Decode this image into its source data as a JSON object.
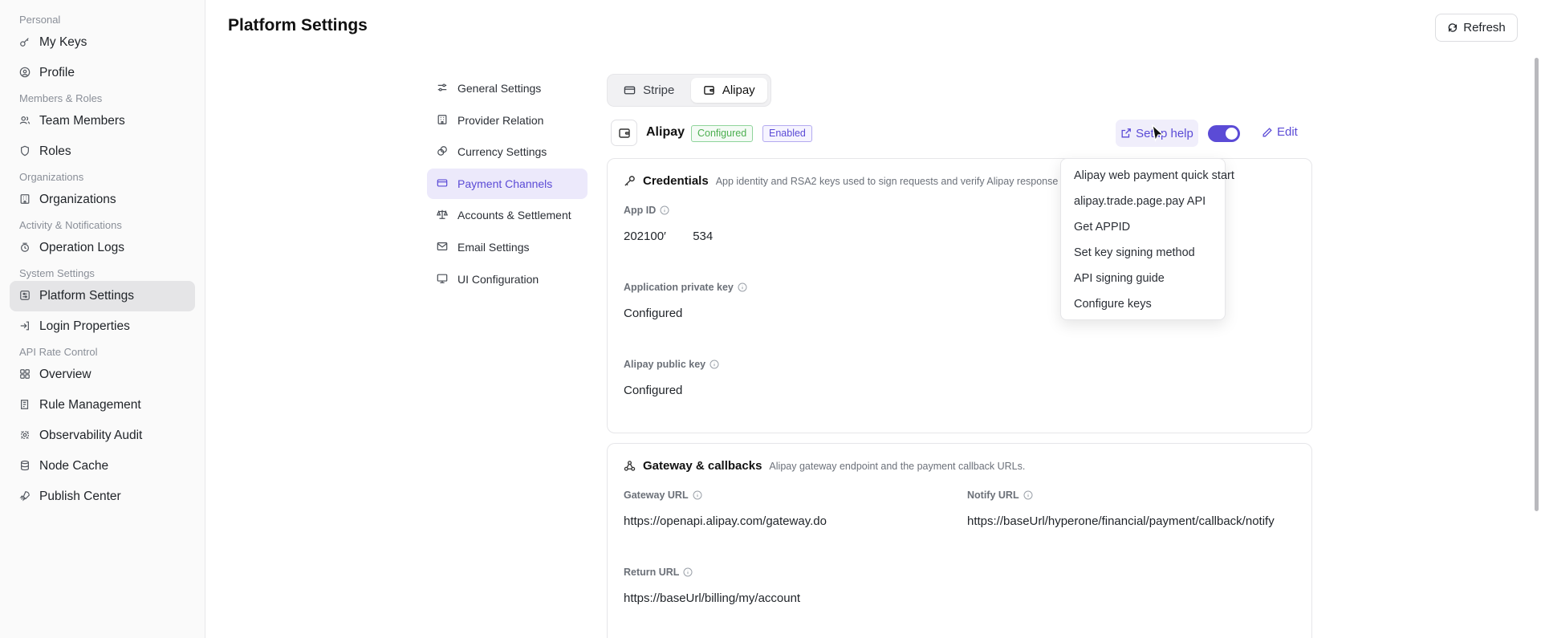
{
  "sidebar": {
    "groups": [
      {
        "label": "Personal",
        "items": [
          {
            "label": "My Keys",
            "icon": "key-icon"
          },
          {
            "label": "Profile",
            "icon": "user-circle-icon"
          }
        ]
      },
      {
        "label": "Members & Roles",
        "items": [
          {
            "label": "Team Members",
            "icon": "users-icon"
          },
          {
            "label": "Roles",
            "icon": "shield-icon"
          }
        ]
      },
      {
        "label": "Organizations",
        "items": [
          {
            "label": "Organizations",
            "icon": "building-icon"
          }
        ]
      },
      {
        "label": "Activity & Notifications",
        "items": [
          {
            "label": "Operation Logs",
            "icon": "log-icon"
          }
        ]
      },
      {
        "label": "System Settings",
        "items": [
          {
            "label": "Platform Settings",
            "icon": "settings-box-icon",
            "active": true
          },
          {
            "label": "Login Properties",
            "icon": "login-icon"
          }
        ]
      },
      {
        "label": "API Rate Control",
        "items": [
          {
            "label": "Overview",
            "icon": "grid-icon"
          },
          {
            "label": "Rule Management",
            "icon": "rules-icon"
          },
          {
            "label": "Observability Audit",
            "icon": "radar-icon"
          },
          {
            "label": "Node Cache",
            "icon": "database-icon"
          },
          {
            "label": "Publish Center",
            "icon": "rocket-icon"
          }
        ]
      }
    ]
  },
  "header": {
    "title": "Platform Settings",
    "refresh_label": "Refresh"
  },
  "settings_nav": [
    {
      "label": "General Settings",
      "icon": "sliders-icon"
    },
    {
      "label": "Provider Relation",
      "icon": "building-icon"
    },
    {
      "label": "Currency Settings",
      "icon": "coins-icon"
    },
    {
      "label": "Payment Channels",
      "icon": "credit-card-icon",
      "active": true
    },
    {
      "label": "Accounts & Settlement",
      "icon": "scale-icon"
    },
    {
      "label": "Email Settings",
      "icon": "mail-icon"
    },
    {
      "label": "UI Configuration",
      "icon": "monitor-icon"
    }
  ],
  "tabs": [
    {
      "label": "Stripe",
      "icon": "credit-card-icon"
    },
    {
      "label": "Alipay",
      "icon": "wallet-icon",
      "active": true
    }
  ],
  "channel": {
    "name": "Alipay",
    "badge_configured": "Configured",
    "badge_enabled": "Enabled",
    "help_label": "Setup help",
    "enabled": true,
    "edit_label": "Edit"
  },
  "credentials": {
    "title": "Credentials",
    "description": "App identity and RSA2 keys used to sign requests and verify Alipay response",
    "app_id_label": "App ID",
    "app_id_value": "202100′        534",
    "private_key_label": "Application private key",
    "private_key_value": "Configured",
    "public_key_label": "Alipay public key",
    "public_key_value": "Configured"
  },
  "gateway": {
    "title": "Gateway & callbacks",
    "description": "Alipay gateway endpoint and the payment callback URLs.",
    "gateway_url_label": "Gateway URL",
    "gateway_url_value": "https://openapi.alipay.com/gateway.do",
    "notify_url_label": "Notify URL",
    "notify_url_value": "https://baseUrl/hyperone/financial/payment/callback/notify",
    "return_url_label": "Return URL",
    "return_url_value": "https://baseUrl/billing/my/account"
  },
  "help_menu": [
    "Alipay web payment quick start",
    "alipay.trade.page.pay API",
    "Get APPID",
    "Set key signing method",
    "API signing guide",
    "Configure keys"
  ],
  "colors": {
    "accent": "#5b4bd6",
    "configured_green": "#4caf50"
  }
}
